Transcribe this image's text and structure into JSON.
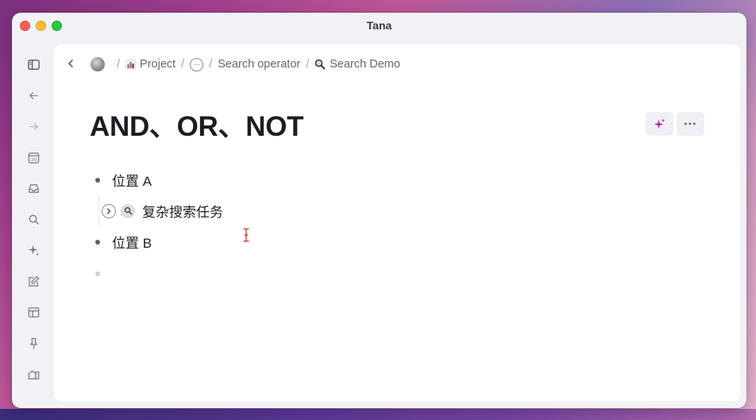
{
  "window": {
    "title": "Tana"
  },
  "breadcrumb": {
    "items": [
      {
        "label": "Project",
        "icon": "bar-chart-icon"
      },
      {
        "label": "Search operator"
      },
      {
        "label": "Search Demo",
        "icon": "magnifier-icon"
      }
    ],
    "ellipsis": "···",
    "separator": "/"
  },
  "page": {
    "title": "AND、OR、NOT",
    "more_label": "···"
  },
  "outline": [
    {
      "text": "位置 A"
    },
    {
      "text": "复杂搜索任务",
      "type": "search-node"
    },
    {
      "text": "位置 B"
    },
    {
      "text": ""
    }
  ],
  "colors": {
    "accent": "#a4359c",
    "background": "#ffffff",
    "sidebar": "#f2f1f6"
  }
}
